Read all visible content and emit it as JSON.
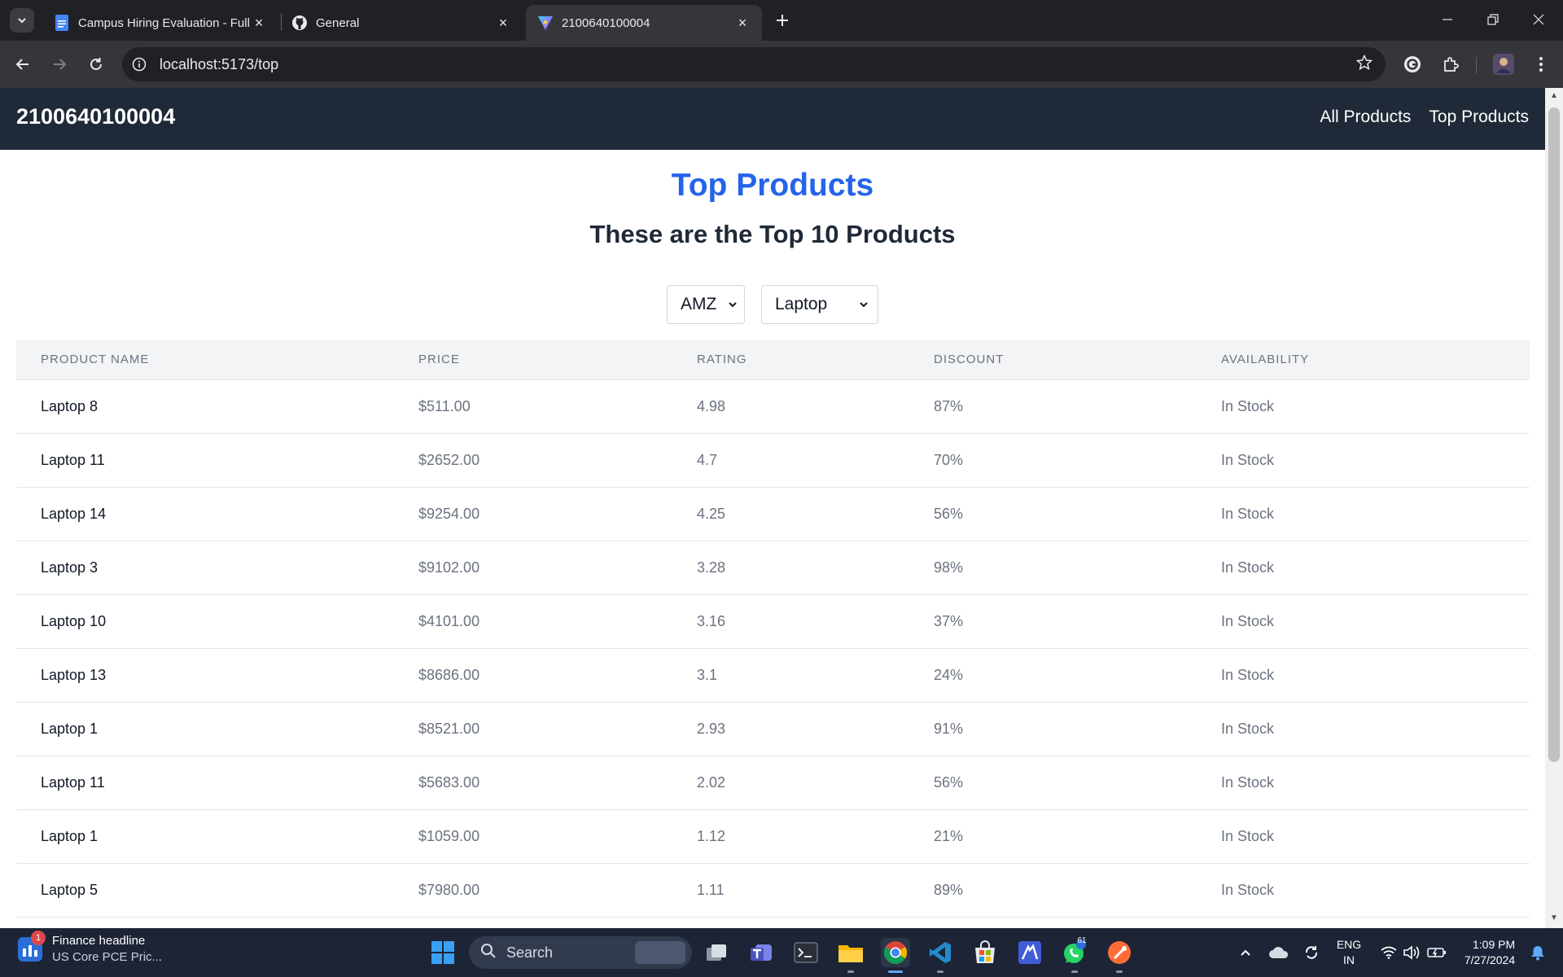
{
  "browser": {
    "tabs": [
      {
        "title": "Campus Hiring Evaluation - Full",
        "icon": "google-docs-icon",
        "active": false
      },
      {
        "title": "General",
        "icon": "github-icon",
        "active": false
      },
      {
        "title": "2100640100004",
        "icon": "vite-icon",
        "active": true
      }
    ],
    "url": "localhost:5173/top"
  },
  "app": {
    "brand": "2100640100004",
    "nav": [
      "All Products",
      "Top Products"
    ],
    "title": "Top Products",
    "subtitle": "These are the Top 10 Products",
    "filters": {
      "company": "AMZ",
      "category": "Laptop"
    },
    "columns": [
      "PRODUCT NAME",
      "PRICE",
      "RATING",
      "DISCOUNT",
      "AVAILABILITY"
    ],
    "rows": [
      {
        "name": "Laptop 8",
        "price": "$511.00",
        "rating": "4.98",
        "discount": "87%",
        "availability": "In Stock"
      },
      {
        "name": "Laptop 11",
        "price": "$2652.00",
        "rating": "4.7",
        "discount": "70%",
        "availability": "In Stock"
      },
      {
        "name": "Laptop 14",
        "price": "$9254.00",
        "rating": "4.25",
        "discount": "56%",
        "availability": "In Stock"
      },
      {
        "name": "Laptop 3",
        "price": "$9102.00",
        "rating": "3.28",
        "discount": "98%",
        "availability": "In Stock"
      },
      {
        "name": "Laptop 10",
        "price": "$4101.00",
        "rating": "3.16",
        "discount": "37%",
        "availability": "In Stock"
      },
      {
        "name": "Laptop 13",
        "price": "$8686.00",
        "rating": "3.1",
        "discount": "24%",
        "availability": "In Stock"
      },
      {
        "name": "Laptop 1",
        "price": "$8521.00",
        "rating": "2.93",
        "discount": "91%",
        "availability": "In Stock"
      },
      {
        "name": "Laptop 11",
        "price": "$5683.00",
        "rating": "2.02",
        "discount": "56%",
        "availability": "In Stock"
      },
      {
        "name": "Laptop 1",
        "price": "$1059.00",
        "rating": "1.12",
        "discount": "21%",
        "availability": "In Stock"
      },
      {
        "name": "Laptop 5",
        "price": "$7980.00",
        "rating": "1.11",
        "discount": "89%",
        "availability": "In Stock"
      }
    ]
  },
  "taskbar": {
    "news_title": "Finance headline",
    "news_sub": "US Core PCE Pric...",
    "news_badge": "1",
    "search_label": "Search",
    "whatsapp_badge": "61",
    "language": "ENG",
    "region": "IN",
    "time": "1:09 PM",
    "date": "7/27/2024",
    "apps": [
      "windows-start-icon",
      "search-icon",
      "task-view-icon",
      "teams-icon",
      "terminal-icon",
      "file-explorer-icon",
      "chrome-icon",
      "vscode-icon",
      "microsoft-store-icon",
      "mongodb-compass-icon",
      "whatsapp-icon",
      "postman-icon"
    ]
  },
  "colors": {
    "appbar": "#1f2937",
    "title": "#2563eb",
    "chrome_dark": "#202124",
    "chrome_toolbar": "#35363a",
    "taskbar": "#1c2435"
  }
}
